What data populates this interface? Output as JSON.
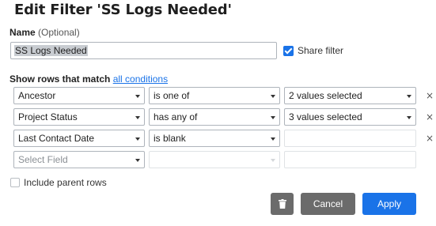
{
  "title": "Edit Filter 'SS Logs Needed'",
  "name_field": {
    "label": "Name",
    "optional": "(Optional)",
    "value": "SS Logs Needed"
  },
  "share": {
    "label": "Share filter",
    "checked": true
  },
  "match": {
    "prefix": "Show rows that match",
    "link": "all conditions"
  },
  "rows": [
    {
      "field": "Ancestor",
      "operator": "is one of",
      "value": "2 values selected",
      "remove": "×"
    },
    {
      "field": "Project Status",
      "operator": "has any of",
      "value": "3 values selected",
      "remove": "×"
    },
    {
      "field": "Last Contact Date",
      "operator": "is blank",
      "value": "",
      "remove": "×"
    },
    {
      "field": "Select Field",
      "operator": "",
      "value": ""
    }
  ],
  "include_parent": {
    "label": "Include parent rows",
    "checked": false
  },
  "buttons": {
    "delete_icon": "trash-icon",
    "cancel": "Cancel",
    "apply": "Apply"
  },
  "colors": {
    "accent": "#1a73e8",
    "secondary_button": "#6b6b6b"
  }
}
